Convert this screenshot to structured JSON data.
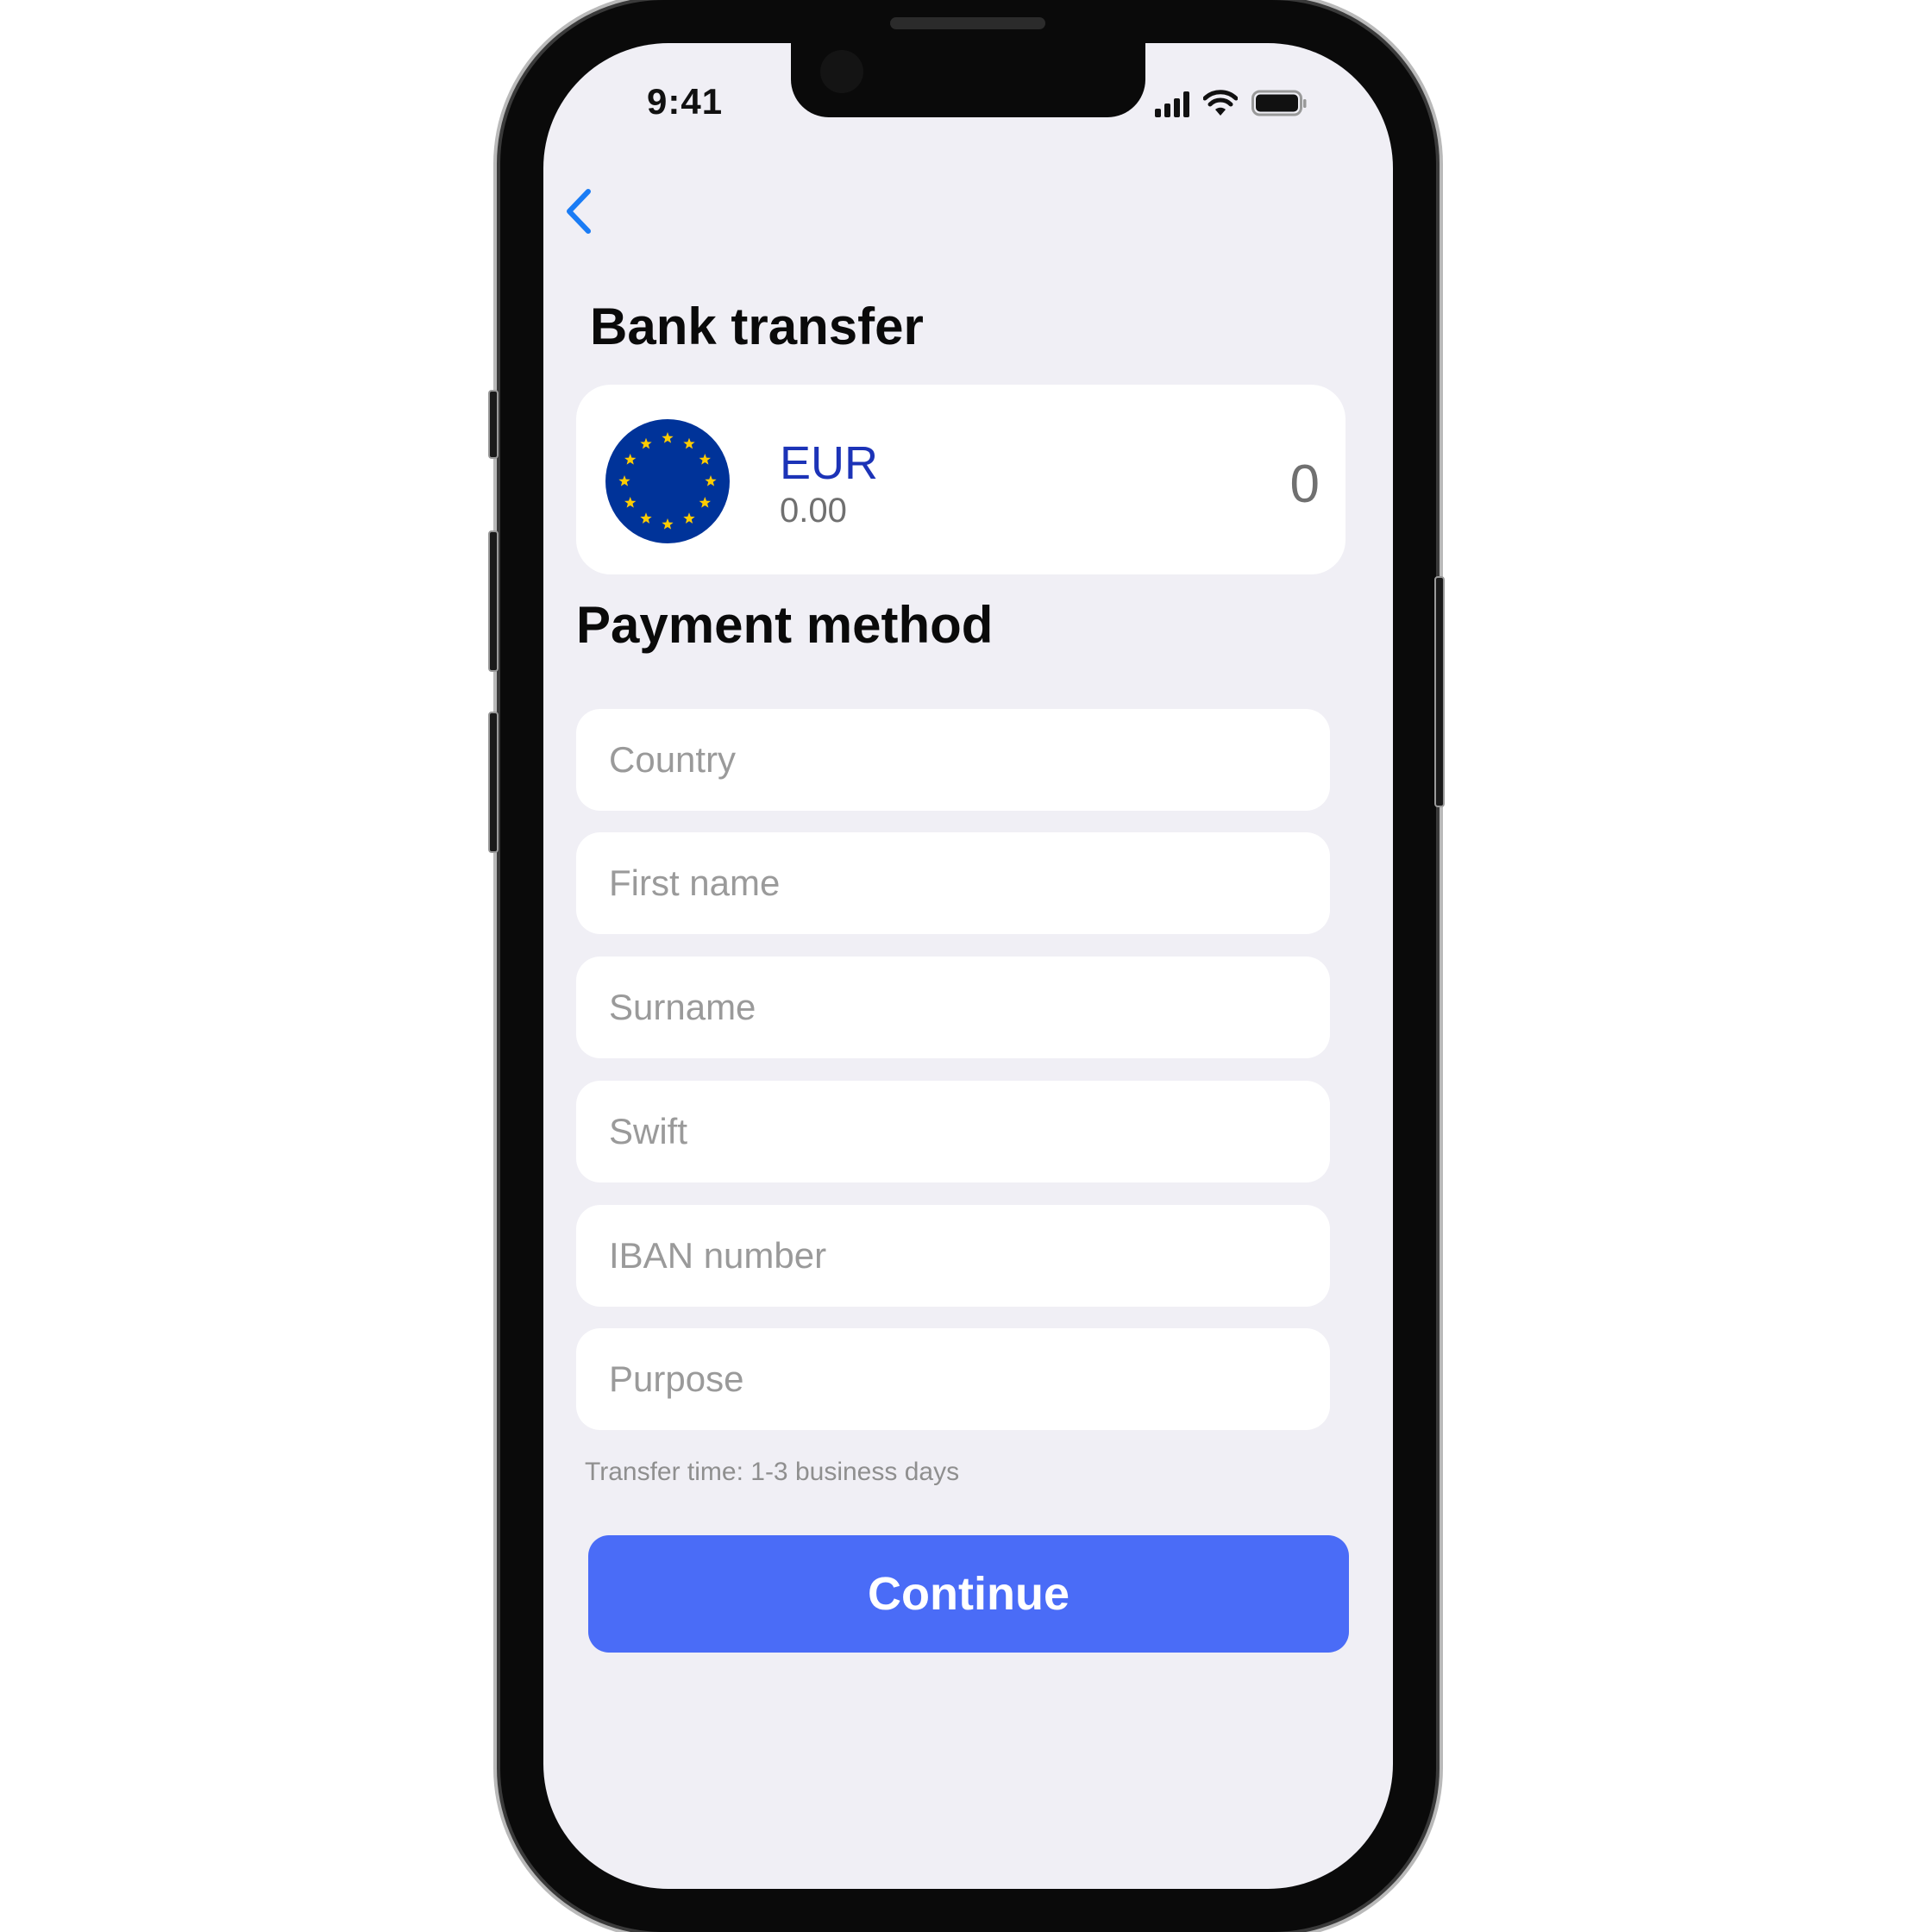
{
  "status_bar": {
    "time": "9:41",
    "icons": [
      "signal-icon",
      "wifi-icon",
      "battery-icon"
    ]
  },
  "nav": {
    "back_icon": "chevron-left-icon"
  },
  "title": "Bank transfer",
  "currency": {
    "code": "EUR",
    "balance": "0.00",
    "amount": "0",
    "flag_icon": "eu-flag-icon"
  },
  "payment": {
    "title": "Payment method",
    "fields": {
      "country": "Country",
      "first_name": "First name",
      "surname": "Surname",
      "swift": "Swift",
      "iban": "IBAN number",
      "purpose": "Purpose"
    },
    "note": "Transfer time: 1-3 business days"
  },
  "continue_label": "Continue",
  "colors": {
    "accent": "#4a6cf7",
    "currency_code": "#1c33b7",
    "eu_blue": "#003399",
    "eu_gold": "#ffcc00",
    "screen_bg": "#f0eff5"
  }
}
